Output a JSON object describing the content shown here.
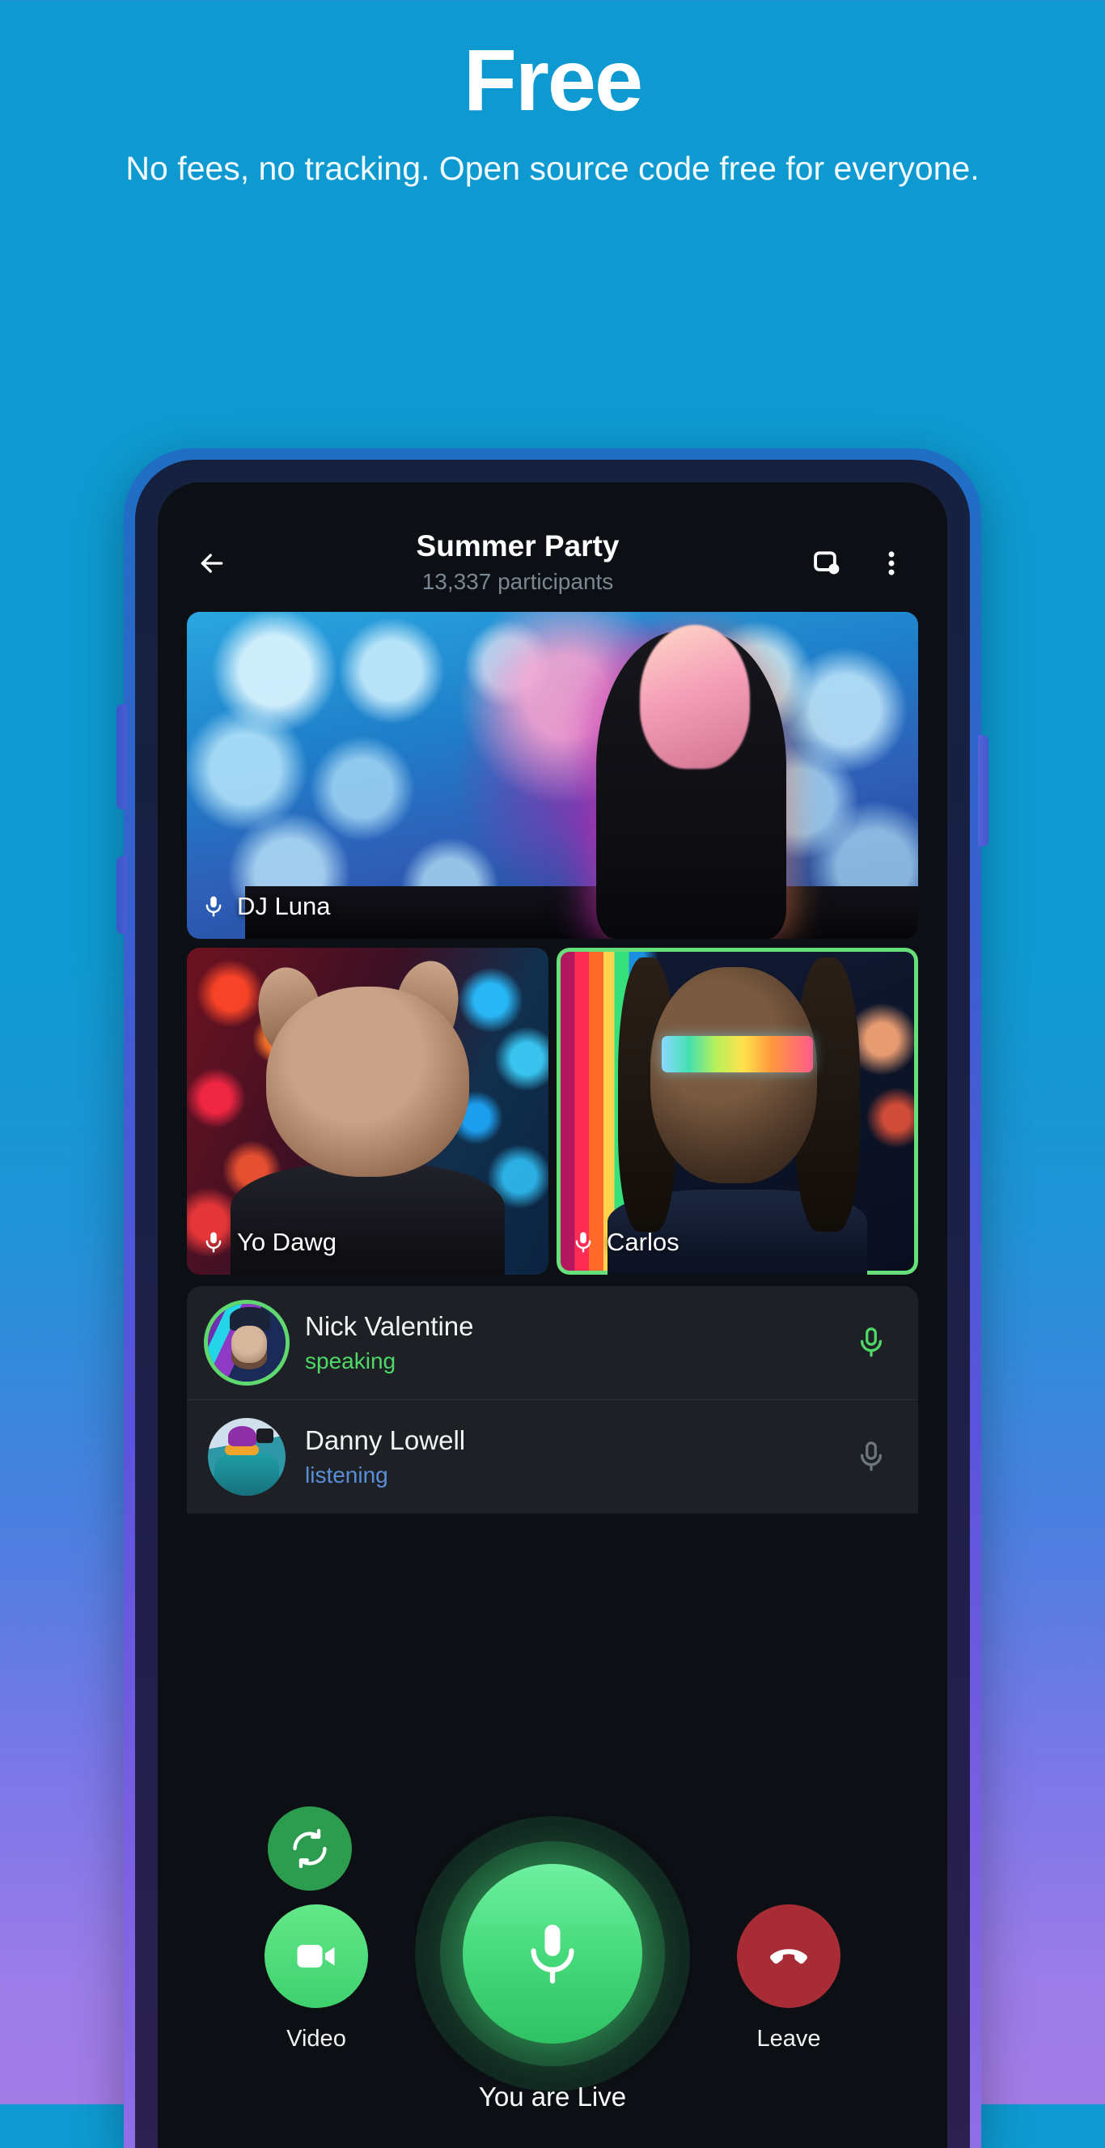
{
  "promo": {
    "title": "Free",
    "subtitle": "No fees, no tracking. Open source code free for everyone."
  },
  "colors": {
    "background_top": "#0e9ad1",
    "background_bottom": "#a37ce6",
    "accent_green": "#4fd866",
    "speaking_green": "#5fd96f",
    "listening_blue": "#5a8fd8",
    "leave_red": "#a82c35",
    "screen_black": "#0c1014",
    "panel_dark": "#1d2126"
  },
  "app": {
    "header": {
      "back_icon": "arrow-left-icon",
      "title": "Summer Party",
      "subtitle": "13,337 participants",
      "cast_icon": "screen-share-icon",
      "menu_icon": "more-vertical-icon"
    },
    "video_tiles": [
      {
        "name": "DJ Luna",
        "mic_icon": "microphone-icon",
        "active_speaker": false,
        "size": "large"
      },
      {
        "name": "Yo Dawg",
        "mic_icon": "microphone-icon",
        "active_speaker": false,
        "size": "small"
      },
      {
        "name": "Carlos",
        "mic_icon": "microphone-icon",
        "active_speaker": true,
        "size": "small"
      }
    ],
    "participants": [
      {
        "name": "Nick Valentine",
        "status": "speaking",
        "status_state": "speaking",
        "mic_icon": "microphone-icon",
        "mic_state": "on"
      },
      {
        "name": "Danny Lowell",
        "status": "listening",
        "status_state": "listening",
        "mic_icon": "microphone-icon",
        "mic_state": "off"
      }
    ],
    "controls": {
      "flip_camera_icon": "flip-camera-icon",
      "video_label": "Video",
      "video_icon": "video-camera-icon",
      "mic_icon": "microphone-icon",
      "live_label": "You are Live",
      "leave_label": "Leave",
      "leave_icon": "phone-hangup-icon"
    }
  }
}
